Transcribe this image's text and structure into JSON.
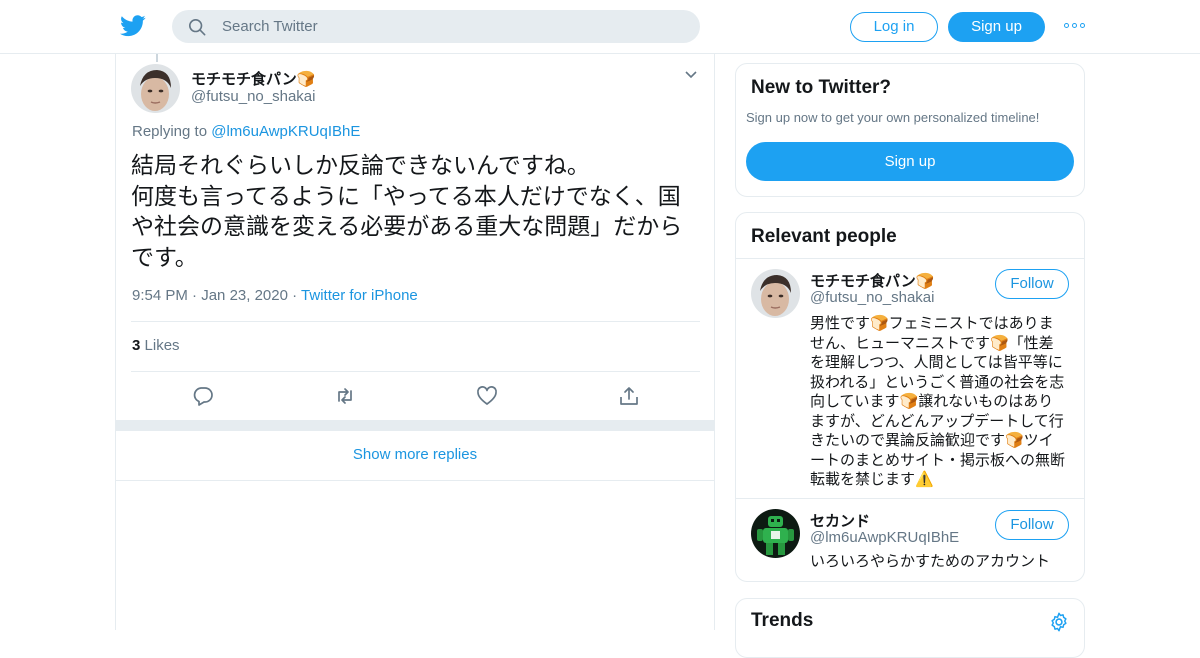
{
  "header": {
    "logo_icon": "twitter-bird-icon",
    "search_placeholder": "Search Twitter",
    "login_label": "Log in",
    "signup_label": "Sign up",
    "more_icon": "more-dots-icon"
  },
  "tweet": {
    "name": "モチモチ食パン🍞",
    "handle": "@futsu_no_shakai",
    "replying_prefix": "Replying to ",
    "replying_to": "@lm6uAwpKRUqIBhE",
    "text_lines": [
      "結局それぐらいしか反論できないんですね。",
      "何度も言ってるように「やってる本人だけでなく、国",
      "や社会の意識を変える必要がある重大な問題」だから",
      "です。"
    ],
    "time": "9:54 PM",
    "date": "Jan 23, 2020",
    "source": "Twitter for iPhone",
    "likes_count": "3",
    "likes_label": "Likes"
  },
  "show_more": "Show more replies",
  "sidebar": {
    "new_title": "New to Twitter?",
    "new_text": "Sign up now to get your own personalized timeline!",
    "new_signup": "Sign up",
    "relevant_title": "Relevant people",
    "people": [
      {
        "name": "モチモチ食パン🍞",
        "handle": "@futsu_no_shakai",
        "follow": "Follow",
        "bio_lines": [
          "男性です🍞フェミニストではありま",
          "せん、ヒューマニストです🍞「性差",
          "を理解しつつ、人間としては皆平等に",
          "扱われる」というごく普通の社会を志",
          "向しています🍞譲れないものはあり",
          "ますが、どんどんアップデートして行",
          "きたいので異論反論歓迎です🍞ツイ",
          "ートのまとめサイト・掲示板への無断",
          "転載を禁じます⚠️"
        ]
      },
      {
        "name": "セカンド",
        "handle": "@lm6uAwpKRUqIBhE",
        "follow": "Follow",
        "bio_lines": [
          "いろいろやらかすためのアカウント"
        ]
      }
    ],
    "trends_title": "Trends"
  },
  "colors": {
    "accent": "#1da1f2",
    "link": "#1b95e0",
    "muted": "#657786",
    "border": "#e6ecf0"
  }
}
